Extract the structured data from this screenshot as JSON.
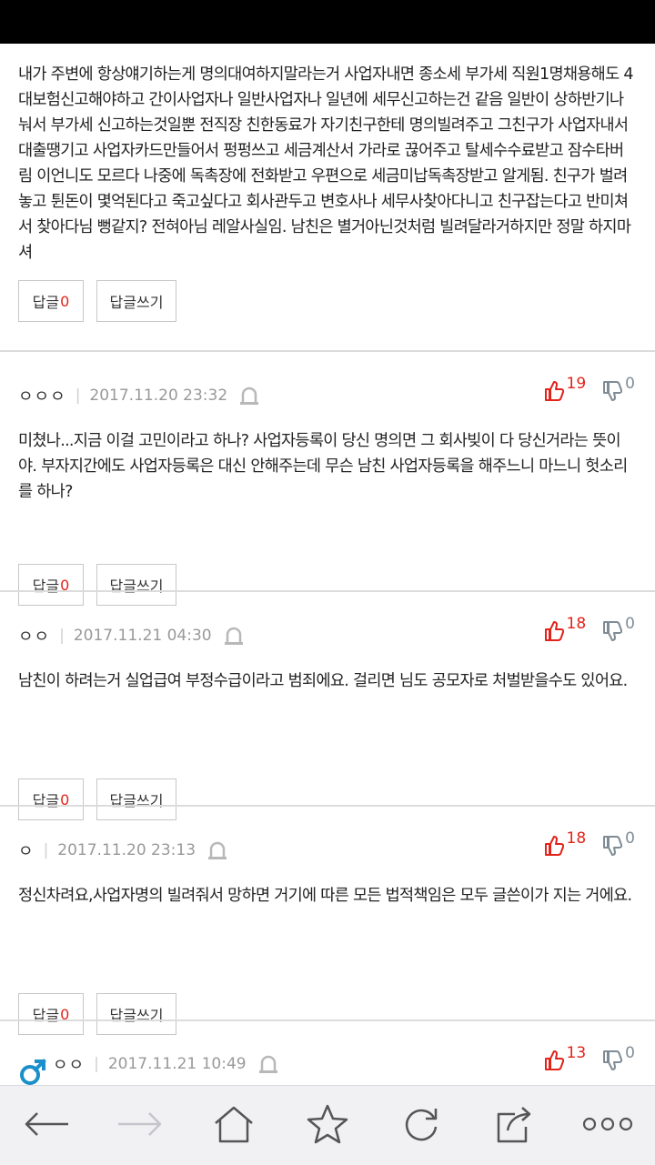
{
  "comments": [
    {
      "text": "내가 주변에 항상얘기하는게 명의대여하지말라는거 사업자내면 종소세 부가세 직원1명채용해도 4대보험신고해야하고 간이사업자나 일반사업자나 일년에 세무신고하는건 같음 일반이 상하반기나눠서 부가세 신고하는것일뿐 전직장 친한동료가 자기친구한테 명의빌려주고 그친구가 사업자내서 대출땡기고 사업자카드만들어서 펑펑쓰고 세금계산서 가라로 끊어주고 탈세수수료받고 잠수타버림 이언니도 모르다 나중에 독촉장에 전화받고 우편으로 세금미납독촉장받고 알게됨. 친구가 벌려놓고 튄돈이 몇억된다고 죽고싶다고 회사관두고 변호사나 세무사찾아다니고 친구잡는다고 반미쳐서 찾아다님 뻥같지? 전혀아님 레알사실임. 남친은 별거아닌것처럼 빌려달라거하지만 정말 하지마셔",
      "reply_label": "답글",
      "reply_count": "0",
      "write_label": "답글쓰기"
    },
    {
      "nick": "ㅇㅇㅇ",
      "date": "2017.11.20 23:32",
      "up": "19",
      "down": "0",
      "text": "미쳤나...지금 이걸 고민이라고 하나? 사업자등록이 당신 명의면 그 회사빚이 다 당신거라는 뜻이야. 부자지간에도 사업자등록은 대신 안해주는데 무슨 남친 사업자등록을 해주느니 마느니 헛소리를 하나?",
      "reply_label": "답글",
      "reply_count": "0",
      "write_label": "답글쓰기"
    },
    {
      "nick": "ㅇㅇ",
      "date": "2017.11.21 04:30",
      "up": "18",
      "down": "0",
      "text": "남친이 하려는거 실업급여 부정수급이라고 범죄에요. 걸리면 님도 공모자로 처벌받을수도 있어요.",
      "reply_label": "답글",
      "reply_count": "0",
      "write_label": "답글쓰기"
    },
    {
      "nick": "ㅇ",
      "date": "2017.11.20 23:13",
      "up": "18",
      "down": "0",
      "text": "정신차려요,사업자명의 빌려줘서 망하면 거기에 따른 모든 법적책임은 모두 글쓴이가 지는 거에요.",
      "reply_label": "답글",
      "reply_count": "0",
      "write_label": "답글쓰기"
    },
    {
      "nick": "ㅇㅇ",
      "date": "2017.11.21 10:49",
      "up": "13",
      "down": "0",
      "gender": "male"
    }
  ],
  "icons": {
    "lock": "lock-icon",
    "up": "thumbs-up-icon",
    "down": "thumbs-down-icon",
    "gender": "male-symbol-icon"
  },
  "nav": [
    "back-icon",
    "forward-icon",
    "home-icon",
    "star-icon",
    "refresh-icon",
    "share-icon",
    "more-icon"
  ],
  "colors": {
    "vote_up": "#e2231a",
    "vote_down": "#7f8c95",
    "gender_male": "#1a8fc9",
    "reply_count": "#e2231a"
  }
}
